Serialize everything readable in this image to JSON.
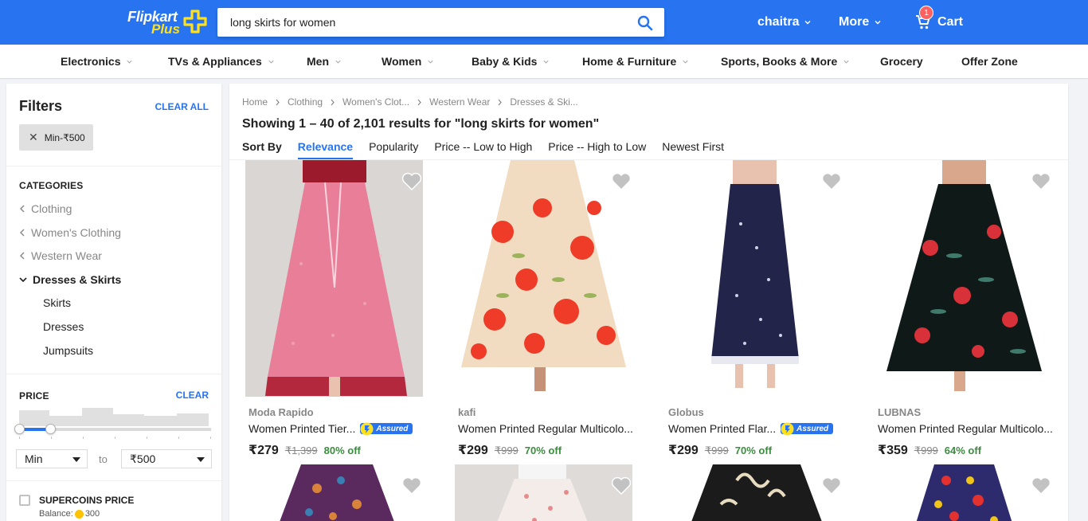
{
  "header": {
    "logo_top": "Flipkart",
    "logo_bottom": "Plus",
    "search_value": "long skirts for women",
    "user": "chaitra",
    "more": "More",
    "cart": "Cart",
    "cart_count": "1",
    "accent": "#2874f0"
  },
  "catnav": [
    "Electronics",
    "TVs & Appliances",
    "Men",
    "Women",
    "Baby & Kids",
    "Home & Furniture",
    "Sports, Books & More",
    "Grocery",
    "Offer Zone"
  ],
  "filters": {
    "title": "Filters",
    "clear_all": "CLEAR ALL",
    "chip": "Min-₹500",
    "categories_title": "CATEGORIES",
    "crumbs": [
      "Clothing",
      "Women's Clothing",
      "Western Wear"
    ],
    "active": "Dresses & Skirts",
    "subs": [
      "Skirts",
      "Dresses",
      "Jumpsuits"
    ],
    "price_title": "PRICE",
    "price_clear": "CLEAR",
    "min": "Min",
    "to": "to",
    "max": "₹500",
    "slider_fill_fraction": 0.16,
    "supercoins_title": "SUPERCOINS PRICE",
    "balance_label": "Balance:",
    "balance_value": "300"
  },
  "results": {
    "breadcrumbs": [
      "Home",
      "Clothing",
      "Women's Clot...",
      "Western Wear",
      "Dresses & Ski..."
    ],
    "title": "Showing 1 – 40 of 2,101 results for \"long skirts for women\"",
    "sort_label": "Sort By",
    "sort_options": [
      "Relevance",
      "Popularity",
      "Price -- Low to High",
      "Price -- High to Low",
      "Newest First"
    ],
    "products": [
      {
        "brand": "Moda Rapido",
        "title": "Women Printed Tier...",
        "assured": true,
        "price": "₹279",
        "mrp": "₹1,399",
        "off": "80% off"
      },
      {
        "brand": "kafi",
        "title": "Women Printed Regular Multicolo...",
        "assured": false,
        "price": "₹299",
        "mrp": "₹999",
        "off": "70% off"
      },
      {
        "brand": "Globus",
        "title": "Women Printed Flar...",
        "assured": true,
        "price": "₹299",
        "mrp": "₹999",
        "off": "70% off"
      },
      {
        "brand": "LUBNAS",
        "title": "Women Printed Regular Multicolo...",
        "assured": false,
        "price": "₹359",
        "mrp": "₹999",
        "off": "64% off"
      }
    ],
    "assured_label": "Assured"
  }
}
